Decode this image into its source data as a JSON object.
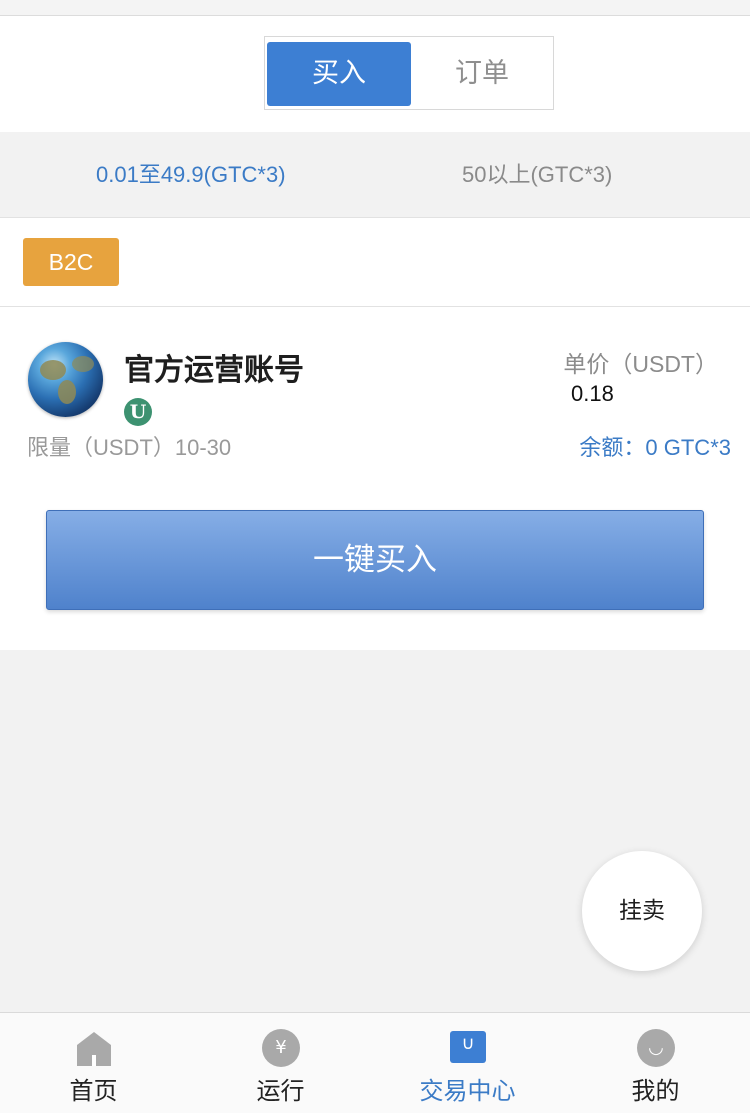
{
  "header": {
    "tabs": [
      {
        "label": "买入",
        "active": true
      },
      {
        "label": "订单",
        "active": false
      }
    ]
  },
  "ranges": [
    {
      "label": "0.01至49.9(GTC*3)",
      "active": true
    },
    {
      "label": "50以上(GTC*3)",
      "active": false
    }
  ],
  "category_badge": "B2C",
  "listing": {
    "merchant_name": "官方运营账号",
    "badge_letter": "U",
    "limit_text": "限量（USDT）10-30",
    "price_label": "单价（USDT）",
    "price_value": "0.18",
    "balance_text": "余额：0 GTC*3",
    "buy_button_label": "一键买入"
  },
  "fab_label": "挂卖",
  "tabbar": {
    "items": [
      {
        "label": "首页",
        "icon": "home-icon",
        "active": false
      },
      {
        "label": "运行",
        "icon": "yen-icon",
        "glyph": "¥",
        "active": false
      },
      {
        "label": "交易中心",
        "icon": "shopping-bag-icon",
        "glyph": "∪",
        "active": true
      },
      {
        "label": "我的",
        "icon": "smile-icon",
        "glyph": "◡",
        "active": false
      }
    ]
  },
  "colors": {
    "accent": "#3d7fd3",
    "badge": "#e7a33e",
    "link": "#3b7bc6",
    "verified": "#3d9271"
  }
}
